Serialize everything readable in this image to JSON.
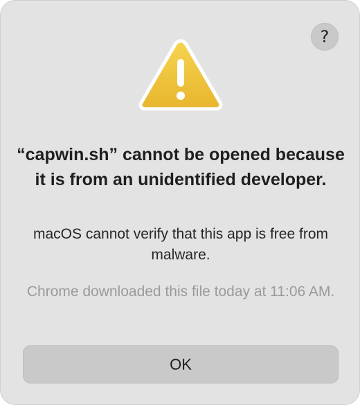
{
  "dialog": {
    "help_label": "?",
    "icon": "warning-triangle-icon",
    "title": "“capwin.sh” cannot be opened because it is from an unidentified developer.",
    "message": "macOS cannot verify that this app is free from malware.",
    "note": "Chrome downloaded this file today at 11:06 AM.",
    "ok_label": "OK"
  },
  "colors": {
    "background": "#e3e3e3",
    "warning_fill": "#f0c53b",
    "warning_stroke": "#ffffff",
    "button": "#c9c9c9",
    "secondary_text": "#9a9a9a"
  }
}
